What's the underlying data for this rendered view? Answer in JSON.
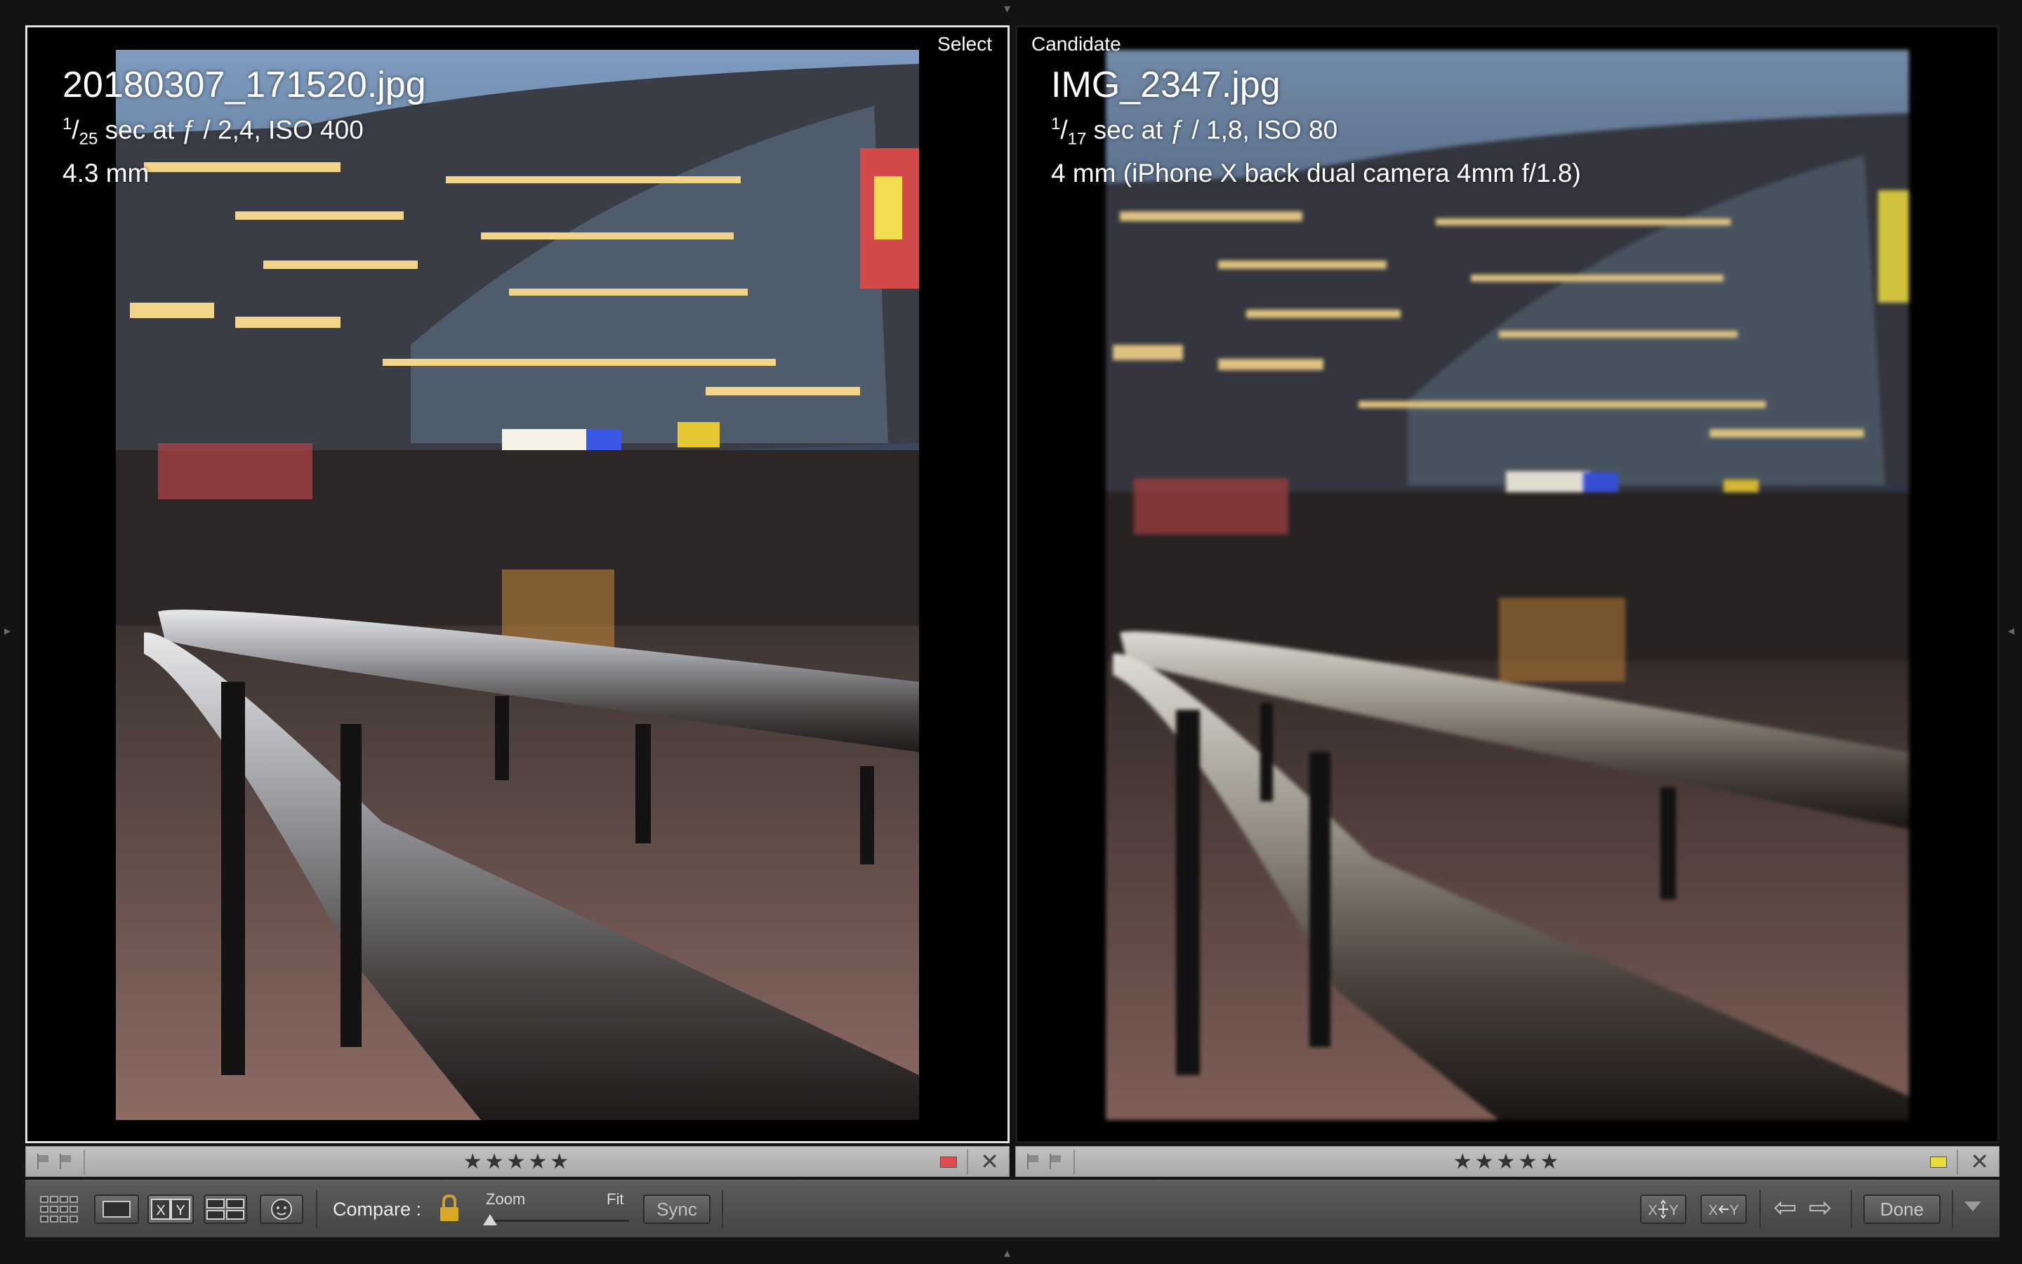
{
  "left_pane": {
    "role": "Select",
    "filename": "20180307_171520.jpg",
    "shutter_numerator": "1",
    "shutter_denominator": "25",
    "exposure_rest": " sec at ƒ / 2,4, ISO 400",
    "focal": "4.3 mm",
    "color_label": "#e24b4b"
  },
  "right_pane": {
    "role": "Candidate",
    "filename": "IMG_2347.jpg",
    "shutter_numerator": "1",
    "shutter_denominator": "17",
    "exposure_rest": " sec at ƒ / 1,8, ISO 80",
    "focal": "4 mm (iPhone X back dual camera 4mm f/1.8)",
    "color_label": "#e8dc3a"
  },
  "rating": {
    "stars": "★★★★★",
    "close": "✕"
  },
  "toolbar": {
    "compare_label": "Compare :",
    "xy_label": "X|Y",
    "zoom_label": "Zoom",
    "fit_label": "Fit",
    "zoom_level": 0,
    "sync_label": "Sync",
    "done_label": "Done",
    "prev_arrow": "⇦",
    "next_arrow": "⇨"
  }
}
